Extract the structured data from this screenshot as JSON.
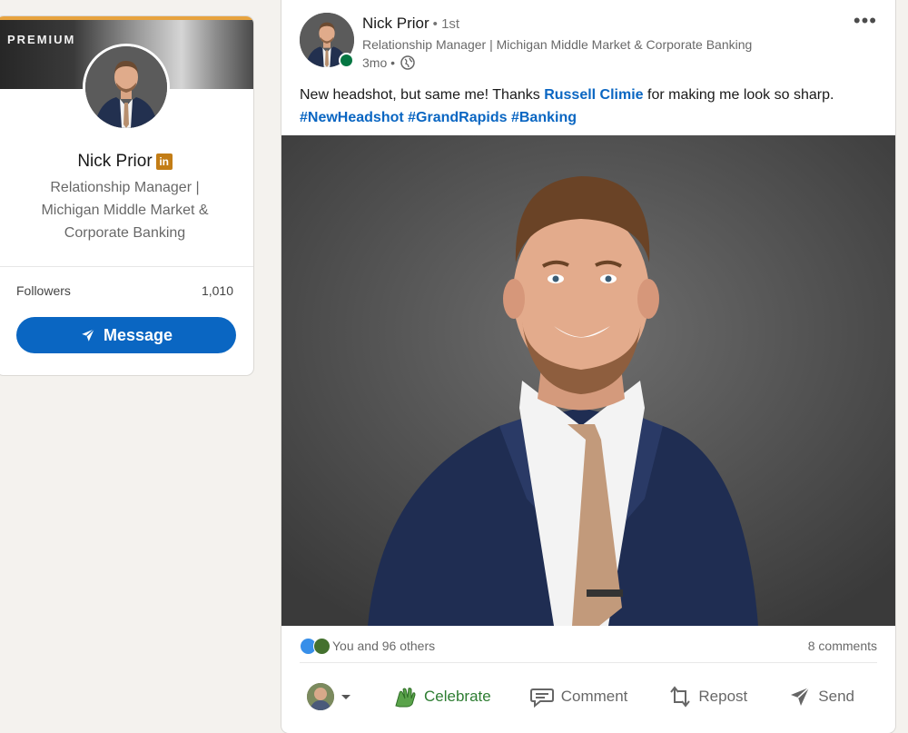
{
  "profile": {
    "badge": "PREMIUM",
    "name": "Nick Prior",
    "network_badge": "in",
    "headline": "Relationship Manager | Michigan Middle Market & Corporate Banking",
    "followers_label": "Followers",
    "followers_count": "1,010",
    "message_button": "Message"
  },
  "post": {
    "author": "Nick Prior",
    "degree": "• 1st",
    "subtitle": "Relationship Manager | Michigan Middle Market & Corporate Banking",
    "time": "3mo •",
    "text_before": "New headshot, but same me! Thanks ",
    "mention": "Russell Climie",
    "text_after": " for making me look so sharp.",
    "hashtags": [
      "#NewHeadshot",
      "#GrandRapids",
      "#Banking"
    ],
    "reactions_text": "You and 96 others",
    "comments_text": "8 comments",
    "actions": {
      "celebrate": "Celebrate",
      "comment": "Comment",
      "repost": "Repost",
      "send": "Send"
    }
  },
  "colors": {
    "brand": "#0a66c2",
    "premium": "#e7a33e",
    "online": "#057642",
    "celebrate": "#2e7d32"
  },
  "icons": [
    "send-icon",
    "globe-icon",
    "more-icon",
    "celebrate-icon",
    "comment-icon",
    "repost-icon",
    "chevron-down-icon",
    "like-reaction-icon",
    "celebrate-reaction-icon"
  ]
}
